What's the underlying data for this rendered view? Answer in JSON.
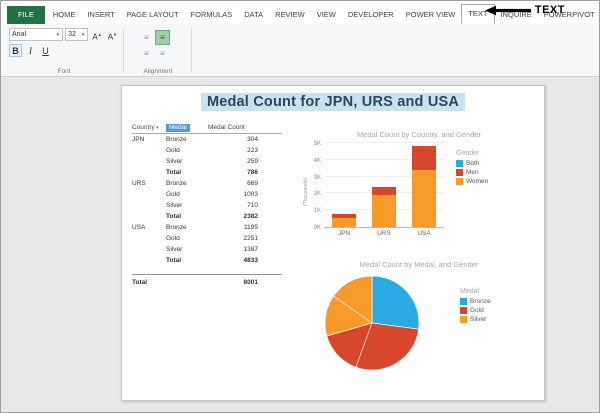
{
  "annotation": {
    "label": "TEXT"
  },
  "ribbon": {
    "tabs": [
      {
        "label": "FILE",
        "file": true
      },
      {
        "label": "HOME"
      },
      {
        "label": "INSERT"
      },
      {
        "label": "PAGE LAYOUT"
      },
      {
        "label": "FORMULAS"
      },
      {
        "label": "DATA"
      },
      {
        "label": "REVIEW"
      },
      {
        "label": "VIEW"
      },
      {
        "label": "DEVELOPER"
      },
      {
        "label": "POWER VIEW"
      },
      {
        "label": "TEXT",
        "selected": true
      },
      {
        "label": "INQUIRE"
      },
      {
        "label": "POWERPIVOT"
      }
    ],
    "font_group": {
      "label": "Font",
      "font_name": "Arial",
      "font_size": "32",
      "bold": "B",
      "italic": "I",
      "underline": "U"
    },
    "alignment_group": {
      "label": "Alignment"
    }
  },
  "report": {
    "title": "Medal Count for JPN, URS and USA",
    "table": {
      "headers": [
        "Country",
        "Medal",
        "Medal Count"
      ],
      "groups": [
        {
          "country": "JPN",
          "rows": [
            [
              "Bronze",
              "304"
            ],
            [
              "Gold",
              "223"
            ],
            [
              "Silver",
              "259"
            ]
          ],
          "total_label": "Total",
          "total": "786"
        },
        {
          "country": "URS",
          "rows": [
            [
              "Bronze",
              "669"
            ],
            [
              "Gold",
              "1003"
            ],
            [
              "Silver",
              "710"
            ]
          ],
          "total_label": "Total",
          "total": "2382"
        },
        {
          "country": "USA",
          "rows": [
            [
              "Bronze",
              "1195"
            ],
            [
              "Gold",
              "2251"
            ],
            [
              "Silver",
              "1387"
            ]
          ],
          "total_label": "Total",
          "total": "4833"
        }
      ],
      "grand_total_label": "Total",
      "grand_total": "8001"
    }
  },
  "chart_data": [
    {
      "type": "bar",
      "stacked": true,
      "title": "Medal Count by Country, and Gender",
      "categories": [
        "JPN",
        "URS",
        "USA"
      ],
      "series": [
        {
          "name": "Both",
          "color": "#29abe2",
          "values": [
            0,
            0,
            0
          ]
        },
        {
          "name": "Men",
          "color": "#d9472b",
          "values": [
            236,
            482,
            1433
          ]
        },
        {
          "name": "Women",
          "color": "#f79a28",
          "values": [
            550,
            1900,
            3400
          ]
        }
      ],
      "stack_bottom_to_top": [
        "Women",
        "Men",
        "Both"
      ],
      "ylabel": "(Thousands)",
      "yticks": [
        "0K",
        "1K",
        "2K",
        "3K",
        "4K",
        "5K"
      ],
      "ylim": [
        0,
        5000
      ],
      "legend_title": "Gender",
      "legend_position": "right"
    },
    {
      "type": "pie",
      "title": "Medal Count by Medal, and Gender",
      "slices": [
        {
          "label": "Bronze",
          "value": 2168,
          "color": "#29abe2"
        },
        {
          "label": "Gold",
          "value": 3477,
          "color": "#d9472b"
        },
        {
          "label": "Silver",
          "value": 2356,
          "color": "#f79a28"
        }
      ],
      "legend_title": "Medal",
      "legend_position": "right"
    }
  ]
}
